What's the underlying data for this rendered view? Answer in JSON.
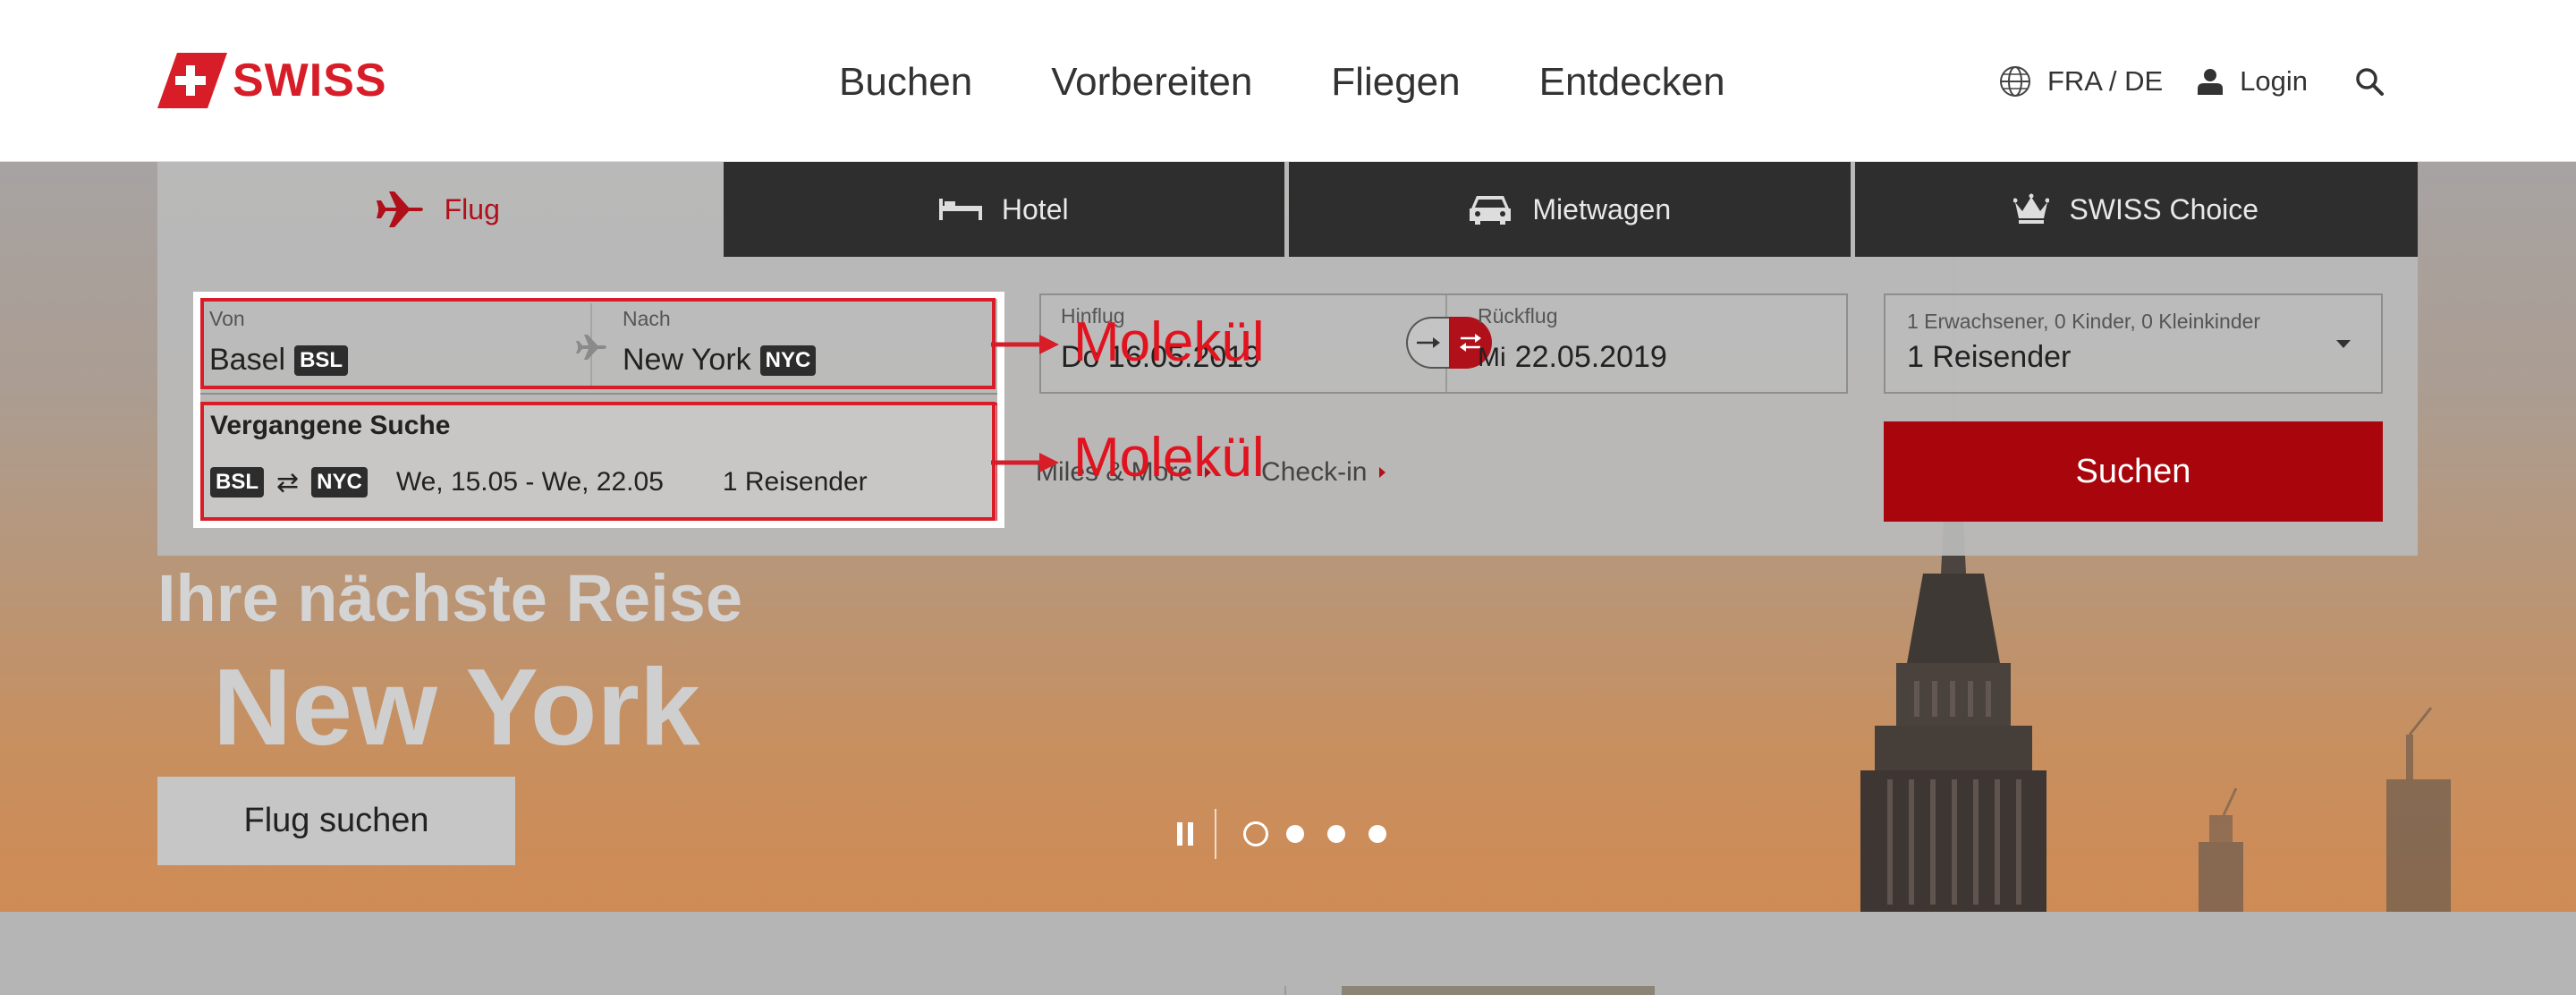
{
  "brand": {
    "name": "SWISS",
    "color": "#d71e28"
  },
  "nav": {
    "items": [
      "Buchen",
      "Vorbereiten",
      "Fliegen",
      "Entdecken"
    ]
  },
  "tools": {
    "language": "FRA / DE",
    "login": "Login",
    "icons": [
      "globe-icon",
      "user-icon",
      "search-icon"
    ]
  },
  "tabs": [
    {
      "label": "Flug",
      "icon": "airplane-icon",
      "active": true
    },
    {
      "label": "Hotel",
      "icon": "bed-icon",
      "active": false
    },
    {
      "label": "Mietwagen",
      "icon": "car-icon",
      "active": false
    },
    {
      "label": "SWISS Choice",
      "icon": "crown-icon",
      "active": false
    }
  ],
  "form": {
    "from_label": "Von",
    "from_value": "Basel",
    "from_code": "BSL",
    "to_label": "Nach",
    "to_value": "New York",
    "to_code": "NYC",
    "outbound_label": "Hinflug",
    "outbound_value": "Do 16.05.2019",
    "return_label": "Rückflug",
    "return_day": "Mi",
    "return_date": "22.05.2019",
    "passengers_label": "1 Erwachsener, 0 Kinder, 0 Kleinkinder",
    "passengers_value": "1 Reisender",
    "search_label": "Suchen"
  },
  "past_search": {
    "title": "Vergangene Suche",
    "from_code": "BSL",
    "to_code": "NYC",
    "dates": "We, 15.05 - We, 22.05",
    "travelers": "1 Reisender"
  },
  "links": {
    "miles": "Miles & More",
    "checkin": "Check-in"
  },
  "annotations": {
    "label_1": "Molekül",
    "label_2": "Molekül",
    "color": "#d71e28"
  },
  "hero": {
    "kicker": "Ihre nächste Reise",
    "title": "New York",
    "cta": "Flug suchen"
  },
  "carousel": {
    "slides": 4,
    "active": 1
  }
}
